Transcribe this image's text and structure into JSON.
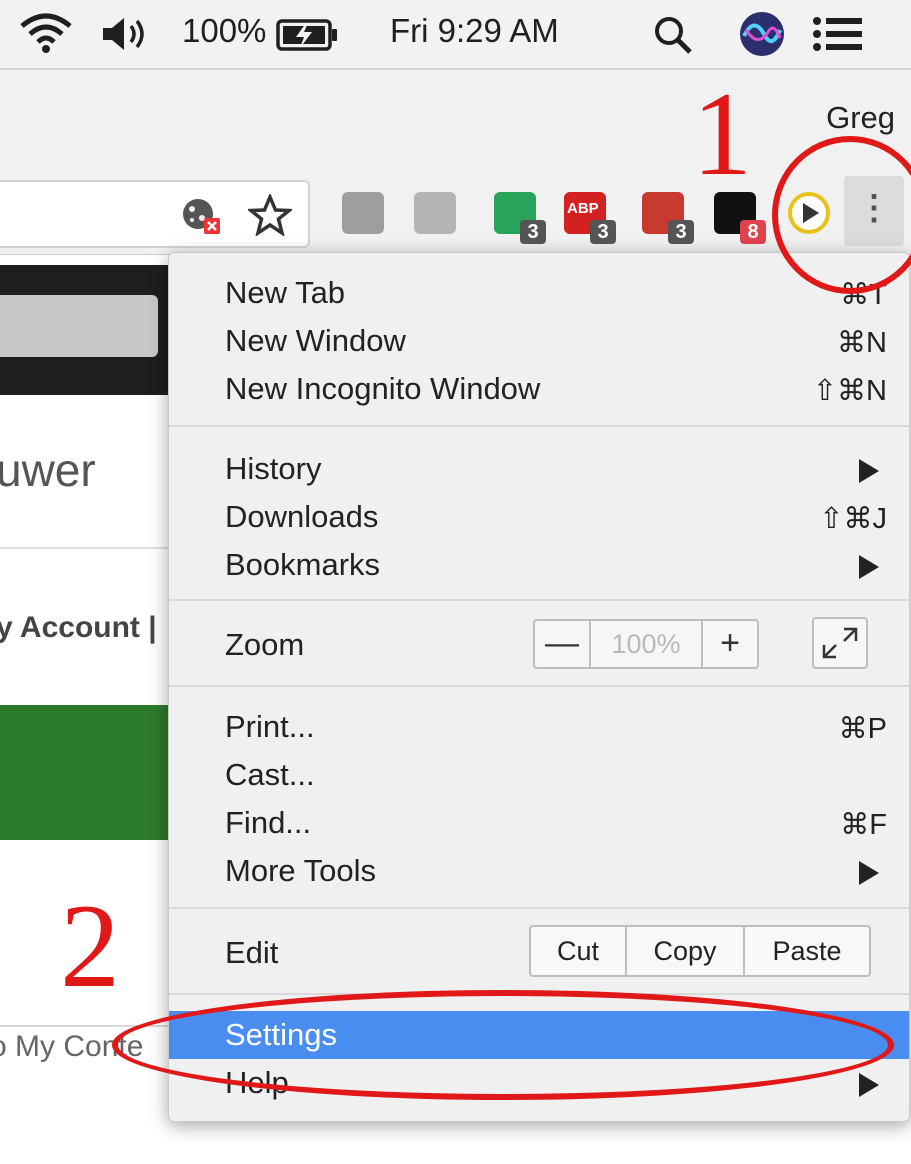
{
  "menubar": {
    "battery": "100%",
    "clock": "Fri 9:29 AM"
  },
  "profile": {
    "name": "Greg"
  },
  "toolbar": {
    "extensions": [
      {
        "name": "s-extension-icon",
        "color": "#9e9e9e",
        "badge": ""
      },
      {
        "name": "google-drive-icon",
        "color": "#b5b5b5",
        "badge": ""
      },
      {
        "name": "green-shield-extension-icon",
        "color": "#27a35a",
        "badge": "3"
      },
      {
        "name": "adblock-icon",
        "color": "#d32020",
        "label": "ABP",
        "badge": "3"
      },
      {
        "name": "red-shield-extension-icon",
        "color": "#c93a2e",
        "badge": "3"
      },
      {
        "name": "amazon-icon",
        "color": "#111111",
        "badge": "8"
      },
      {
        "name": "play-extension-icon",
        "color": "#ffffff",
        "badge": ""
      }
    ]
  },
  "page": {
    "heading": "uwer",
    "account": "y Account |",
    "content": "o My Conte"
  },
  "menu": {
    "new_tab": {
      "label": "New Tab",
      "shortcut": "⌘T"
    },
    "new_window": {
      "label": "New Window",
      "shortcut": "⌘N"
    },
    "new_incognito": {
      "label": "New Incognito Window",
      "shortcut": "⇧⌘N"
    },
    "history": {
      "label": "History"
    },
    "downloads": {
      "label": "Downloads",
      "shortcut": "⇧⌘J"
    },
    "bookmarks": {
      "label": "Bookmarks"
    },
    "zoom": {
      "label": "Zoom",
      "value": "100%",
      "minus": "—",
      "plus": "+"
    },
    "print": {
      "label": "Print...",
      "shortcut": "⌘P"
    },
    "cast": {
      "label": "Cast..."
    },
    "find": {
      "label": "Find...",
      "shortcut": "⌘F"
    },
    "more_tools": {
      "label": "More Tools"
    },
    "edit": {
      "label": "Edit",
      "cut": "Cut",
      "copy": "Copy",
      "paste": "Paste"
    },
    "settings": {
      "label": "Settings"
    },
    "help": {
      "label": "Help"
    }
  },
  "annotations": {
    "step1": "1",
    "step2": "2",
    "color": "#e01818"
  }
}
